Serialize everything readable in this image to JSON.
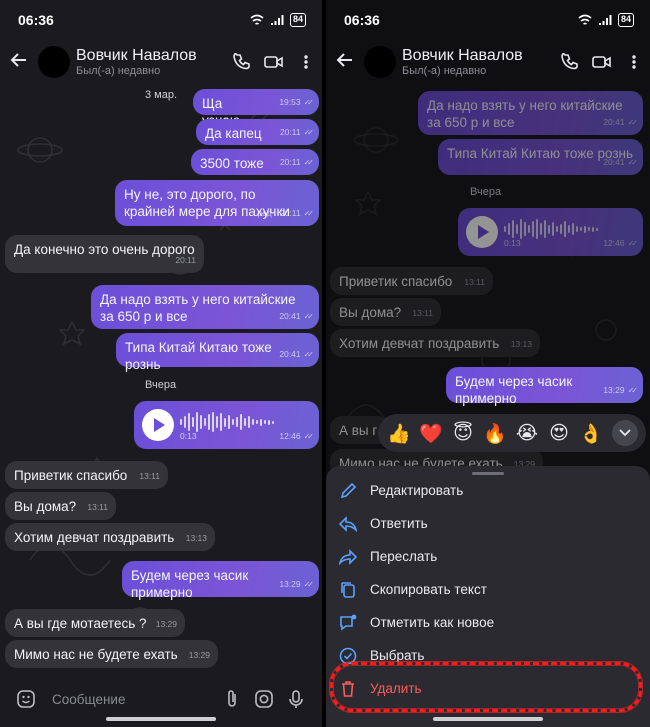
{
  "status": {
    "time": "06:36",
    "battery": "84"
  },
  "contact": {
    "name": "Вовчик Навалов",
    "status": "Был(-а) недавно"
  },
  "left": {
    "date_sep_top": "3 мар.",
    "date_sep_yesterday": "Вчера",
    "messages": [
      {
        "text": "Ща узнаю",
        "time": "19:53",
        "dir": "out"
      },
      {
        "text": "Да капец",
        "time": "20:11",
        "dir": "out"
      },
      {
        "text": "3500 тоже",
        "time": "20:11",
        "dir": "out"
      },
      {
        "text": "Ну не, это дорого, по крайней мере для пахучки",
        "time": "20:11",
        "edited": "ред",
        "dir": "out"
      },
      {
        "text": "Да конечно это очень дорого",
        "time": "20:11",
        "dir": "in"
      },
      {
        "text": "Да надо взять у него китайские за 650 р и все",
        "time": "20:41",
        "dir": "out"
      },
      {
        "text": "Типа Китай Китаю тоже рознь",
        "time": "20:41",
        "dir": "out"
      },
      {
        "voice_duration": "0:13",
        "time": "12:46",
        "dir": "out"
      },
      {
        "text": "Приветик спасибо",
        "time": "13:11",
        "dir": "in"
      },
      {
        "text": "Вы дома?",
        "time": "13:11",
        "dir": "in"
      },
      {
        "text": "Хотим девчат поздравить",
        "time": "13:13",
        "dir": "in"
      },
      {
        "text": "Будем через часик примерно",
        "time": "13:29",
        "dir": "out"
      },
      {
        "text": "А вы где мотаетесь ?",
        "time": "13:29",
        "dir": "in"
      },
      {
        "text": "Мимо нас не будете ехать",
        "time": "13:29",
        "dir": "in"
      }
    ],
    "input_placeholder": "Сообщение"
  },
  "right": {
    "date_sep_yesterday": "Вчера",
    "messages": [
      {
        "text": "Да надо взять у него китайские за 650 р и все",
        "time": "20:41"
      },
      {
        "text": "Типа Китай Китаю тоже рознь",
        "time": "20:41"
      },
      {
        "voice_duration": "0:13",
        "time": "12:46"
      },
      {
        "text": "Приветик спасибо",
        "time": "13:11"
      },
      {
        "text": "Вы дома?",
        "time": "13:11"
      },
      {
        "text": "Хотим девчат поздравить",
        "time": "13:13"
      },
      {
        "text": "Будем через часик примерно",
        "time": "13:29"
      },
      {
        "text": "А вы г",
        "time": ""
      },
      {
        "text": "Мимо нас не будете ехать",
        "time": "13:29"
      }
    ],
    "reactions": [
      "👍",
      "❤️",
      "😇",
      "🔥",
      "😭",
      "😍",
      "👌"
    ],
    "menu": [
      {
        "label": "Редактировать",
        "icon": "pencil-icon"
      },
      {
        "label": "Ответить",
        "icon": "reply-icon"
      },
      {
        "label": "Переслать",
        "icon": "forward-icon"
      },
      {
        "label": "Скопировать текст",
        "icon": "copy-icon"
      },
      {
        "label": "Отметить как новое",
        "icon": "mark-unread-icon"
      },
      {
        "label": "Выбрать",
        "icon": "check-circle-icon"
      },
      {
        "label": "Удалить",
        "icon": "trash-icon"
      }
    ]
  },
  "colors": {
    "accent": "#7b55d6",
    "incoming": "#333338",
    "danger": "#ff5b5b",
    "annotation": "#ff1a1a"
  }
}
